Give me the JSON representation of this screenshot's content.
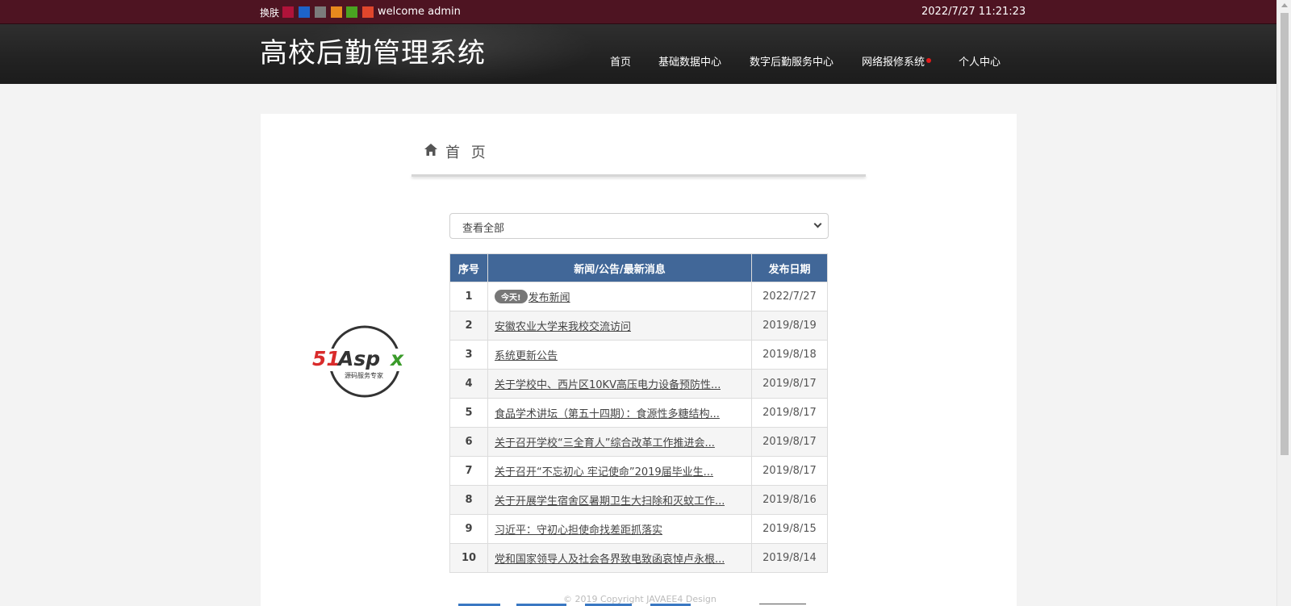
{
  "topbar": {
    "skin_label": "换肤",
    "skin_colors": [
      "#b0133a",
      "#1d63c9",
      "#7b7b7b",
      "#e8891d",
      "#4aa321",
      "#e0462c"
    ],
    "welcome": "welcome admin",
    "datetime": "2022/7/27 11:21:23"
  },
  "header": {
    "site_title": "高校后勤管理系统",
    "nav": [
      "首页",
      "基础数据中心",
      "数字后勤服务中心",
      "网络报修系统",
      "个人中心"
    ]
  },
  "breadcrumb": {
    "label": "首 页",
    "icon": "home-icon"
  },
  "filter": {
    "selected": "查看全部"
  },
  "table": {
    "headers": [
      "序号",
      "新闻/公告/最新消息",
      "发布日期"
    ],
    "today_badge": "今天!",
    "rows": [
      {
        "no": "1",
        "title": "发布新闻",
        "date": "2022/7/27"
      },
      {
        "no": "2",
        "title": "安徽农业大学来我校交流访问",
        "date": "2019/8/19"
      },
      {
        "no": "3",
        "title": "系统更新公告",
        "date": "2019/8/18"
      },
      {
        "no": "4",
        "title": "关于学校中、西片区10KV高压电力设备预防性...",
        "date": "2019/8/17"
      },
      {
        "no": "5",
        "title": "食品学术讲坛（第五十四期）：食源性多糖结构...",
        "date": "2019/8/17"
      },
      {
        "no": "6",
        "title": "关于召开学校“三全育人”综合改革工作推进会...",
        "date": "2019/8/17"
      },
      {
        "no": "7",
        "title": "关于召开“不忘初心 牢记使命”2019届毕业生...",
        "date": "2019/8/17"
      },
      {
        "no": "8",
        "title": "关于开展学生宿舍区暑期卫生大扫除和灭蚊工作...",
        "date": "2019/8/16"
      },
      {
        "no": "9",
        "title": "习近平：守初心担使命找差距抓落实",
        "date": "2019/8/15"
      },
      {
        "no": "10",
        "title": "党和国家领导人及社会各界致电致函哀悼卢永根...",
        "date": "2019/8/14"
      }
    ]
  },
  "logo": {
    "brand": "51Aspx",
    "tagline": "源码服务专家"
  },
  "footer": {
    "copyright": "© 2019 Copyright JAVAEE4 Design"
  }
}
